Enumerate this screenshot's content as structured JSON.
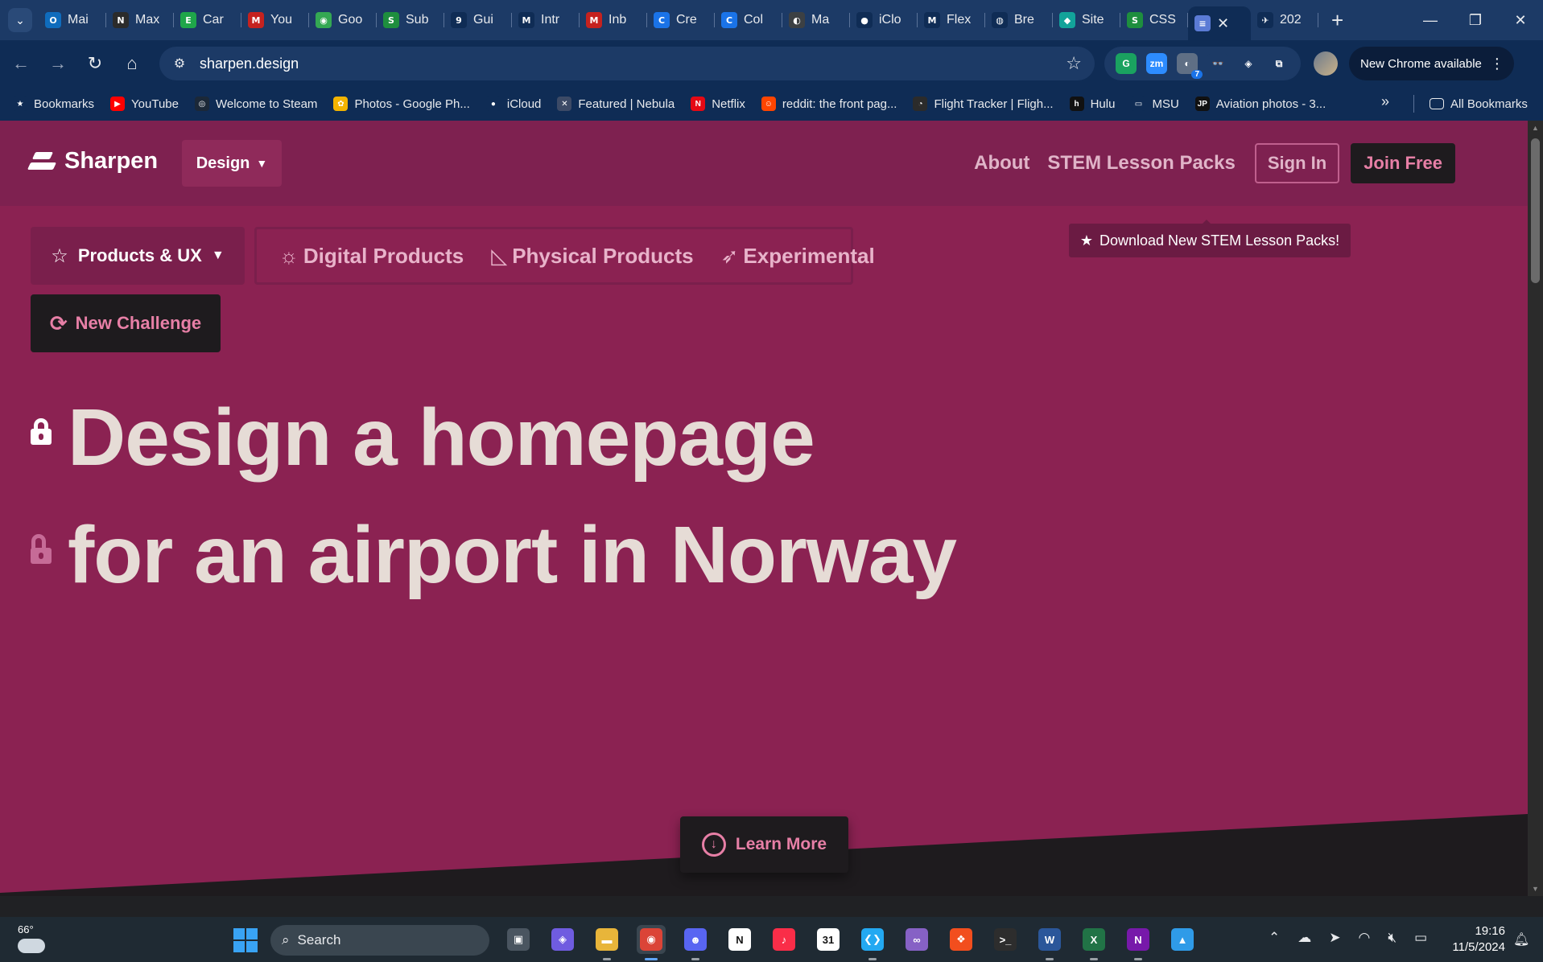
{
  "browser": {
    "tabs": [
      {
        "title": "Mai",
        "icon": "outlook-icon",
        "color": "#0f6cbd",
        "glyph": "O"
      },
      {
        "title": "Max",
        "icon": "notion-icon",
        "color": "#2b2b2b",
        "glyph": "N"
      },
      {
        "title": "Car",
        "icon": "e-icon",
        "color": "#1fa64a",
        "glyph": "E"
      },
      {
        "title": "You",
        "icon": "gmail-icon",
        "color": "#c5221f",
        "glyph": "M"
      },
      {
        "title": "Goo",
        "icon": "maps-icon",
        "color": "#34a853",
        "glyph": "◉"
      },
      {
        "title": "Sub",
        "icon": "s-icon",
        "color": "#1e8e3e",
        "glyph": "S"
      },
      {
        "title": "Gui",
        "icon": "g-icon",
        "color": "#0f2c55",
        "glyph": "9"
      },
      {
        "title": "Intr",
        "icon": "m-icon",
        "color": "#0f2c55",
        "glyph": "M"
      },
      {
        "title": "Inb",
        "icon": "gmail-icon",
        "color": "#c5221f",
        "glyph": "M"
      },
      {
        "title": "Cre",
        "icon": "c-icon",
        "color": "#1a73e8",
        "glyph": "C"
      },
      {
        "title": "Col",
        "icon": "c-icon",
        "color": "#1a73e8",
        "glyph": "C"
      },
      {
        "title": "Ma",
        "icon": "apple-icon",
        "color": "#3c4043",
        "glyph": "◐"
      },
      {
        "title": "iClo",
        "icon": "apple-icon",
        "color": "#0f2c55",
        "glyph": "●"
      },
      {
        "title": "Flex",
        "icon": "m-icon",
        "color": "#0f2c55",
        "glyph": "M"
      },
      {
        "title": "Bre",
        "icon": "github-icon",
        "color": "#0f2c55",
        "glyph": "◍"
      },
      {
        "title": "Site",
        "icon": "diamond-icon",
        "color": "#12a39a",
        "glyph": "◆"
      },
      {
        "title": "CSS",
        "icon": "s-icon",
        "color": "#1e8e3e",
        "glyph": "S"
      },
      {
        "title": "",
        "icon": "sharpen-tab-icon",
        "color": "#5b7bd5",
        "glyph": "≡",
        "active": true
      },
      {
        "title": "202",
        "icon": "flight-icon",
        "color": "#0f2c55",
        "glyph": "✈"
      }
    ],
    "url": "sharpen.design",
    "update_button": "New Chrome available",
    "extensions": [
      {
        "name": "grammar-extension-icon",
        "color": "#1aa260",
        "glyph": "G"
      },
      {
        "name": "zoom-extension-icon",
        "color": "#2d8cff",
        "glyph": "zm"
      },
      {
        "name": "chrome-extension-icon",
        "color": "#5f6f85",
        "glyph": "◐",
        "badge": "7"
      },
      {
        "name": "glasses-extension-icon",
        "color": "#1c3a66",
        "glyph": "👓"
      },
      {
        "name": "honey-extension-icon",
        "color": "#1c3a66",
        "glyph": "◈"
      },
      {
        "name": "puzzle-extension-icon",
        "color": "#1c3a66",
        "glyph": "⧉"
      }
    ],
    "bookmarks": [
      {
        "label": "Bookmarks",
        "icon": "star-icon",
        "color": "#0f2c55",
        "glyph": "★"
      },
      {
        "label": "YouTube",
        "icon": "youtube-icon",
        "color": "#ff0000",
        "glyph": "▶"
      },
      {
        "label": "Welcome to Steam",
        "icon": "steam-icon",
        "color": "#1b2838",
        "glyph": "◎"
      },
      {
        "label": "Photos - Google Ph...",
        "icon": "photos-icon",
        "color": "#f4b400",
        "glyph": "✿"
      },
      {
        "label": "iCloud",
        "icon": "apple-icon",
        "color": "#0f2c55",
        "glyph": "●"
      },
      {
        "label": "Featured | Nebula",
        "icon": "nebula-icon",
        "color": "#3c4a66",
        "glyph": "✕"
      },
      {
        "label": "Netflix",
        "icon": "netflix-icon",
        "color": "#e50914",
        "glyph": "N"
      },
      {
        "label": "reddit: the front pag...",
        "icon": "reddit-icon",
        "color": "#ff4500",
        "glyph": "☺"
      },
      {
        "label": "Flight Tracker | Fligh...",
        "icon": "flightradar-icon",
        "color": "#2b2b2b",
        "glyph": "◔"
      },
      {
        "label": "Hulu",
        "icon": "hulu-icon",
        "color": "#111",
        "glyph": "h"
      },
      {
        "label": "MSU",
        "icon": "folder-icon",
        "color": "#0f2c55",
        "glyph": "▭"
      },
      {
        "label": "Aviation photos - 3...",
        "icon": "jp-icon",
        "color": "#111",
        "glyph": "JP"
      }
    ],
    "all_bookmarks": "All Bookmarks"
  },
  "site": {
    "brand": "Sharpen",
    "design_dropdown": "Design",
    "nav": {
      "about": "About",
      "stem": "STEM Lesson Packs",
      "sign_in": "Sign In",
      "join": "Join Free"
    },
    "stem_banner": "Download New STEM Lesson Packs!",
    "category_dropdown": "Products & UX",
    "subcategories": [
      {
        "label": "Digital Products",
        "icon": "bug-icon",
        "glyph": "☼"
      },
      {
        "label": "Physical Products",
        "icon": "set-square-icon",
        "glyph": "◺"
      },
      {
        "label": "Experimental",
        "icon": "rocket-icon",
        "glyph": "➶"
      }
    ],
    "new_challenge": "New Challenge",
    "headline_line1": "Design a homepage",
    "headline_line2": "for an airport in Norway",
    "learn_more": "Learn More",
    "colors": {
      "background": "#8b2252",
      "header": "#7e2150",
      "dark": "#1e1b1e",
      "accent_pink": "#e77fa6",
      "headline": "#e6dcd6"
    }
  },
  "taskbar": {
    "temperature": "66°",
    "search_placeholder": "Search",
    "apps": [
      {
        "name": "task-view-icon",
        "color": "#4a5560",
        "glyph": "▣",
        "run": false
      },
      {
        "name": "copilot-icon",
        "color": "#6f5ce0",
        "glyph": "◈",
        "run": false
      },
      {
        "name": "file-explorer-icon",
        "color": "#e8b53a",
        "glyph": "▬",
        "run": true
      },
      {
        "name": "chrome-icon",
        "color": "#db4437",
        "glyph": "◉",
        "run": true,
        "focus": true
      },
      {
        "name": "discord-icon",
        "color": "#5865f2",
        "glyph": "☻",
        "run": true
      },
      {
        "name": "notion-icon",
        "color": "#ffffff",
        "glyph": "N",
        "run": false
      },
      {
        "name": "music-icon",
        "color": "#fa2d48",
        "glyph": "♪",
        "run": false
      },
      {
        "name": "calendar-icon",
        "color": "#ffffff",
        "glyph": "31",
        "run": false
      },
      {
        "name": "vscode-icon",
        "color": "#23a9f2",
        "glyph": "❮❯",
        "run": true
      },
      {
        "name": "visual-studio-icon",
        "color": "#8661c5",
        "glyph": "∞",
        "run": false
      },
      {
        "name": "figma-icon",
        "color": "#f24e1e",
        "glyph": "❖",
        "run": false
      },
      {
        "name": "terminal-icon",
        "color": "#2d2d2d",
        "glyph": ">_",
        "run": false
      },
      {
        "name": "word-icon",
        "color": "#2b579a",
        "glyph": "W",
        "run": true
      },
      {
        "name": "excel-icon",
        "color": "#217346",
        "glyph": "X",
        "run": true
      },
      {
        "name": "onenote-icon",
        "color": "#7719aa",
        "glyph": "N",
        "run": true
      },
      {
        "name": "photos-app-icon",
        "color": "#2f9be8",
        "glyph": "▲",
        "run": false
      }
    ],
    "time": "19:16",
    "date": "11/5/2024"
  }
}
